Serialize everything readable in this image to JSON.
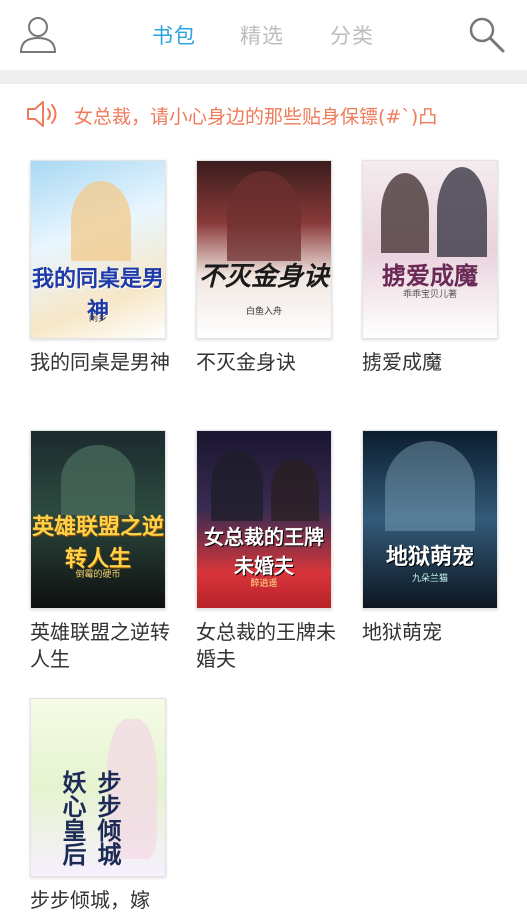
{
  "header": {
    "tabs": [
      {
        "label": "书包",
        "active": true
      },
      {
        "label": "精选",
        "active": false
      },
      {
        "label": "分类",
        "active": false
      }
    ],
    "user_icon": "user-icon",
    "search_icon": "search-icon"
  },
  "notice": {
    "icon": "speaker-icon",
    "text": "女总裁，请小心身边的那些贴身保镖(#`)凸"
  },
  "colors": {
    "accent": "#2aa3e0",
    "inactive_tab": "#bdbdbd",
    "notice_text": "#f07b5b"
  },
  "books": [
    {
      "title": "我的同桌是男神",
      "cover_title": "我的同桌是男神",
      "cover_author": "闲乡"
    },
    {
      "title": "不灭金身诀",
      "cover_title": "不灭金身诀",
      "cover_author": "白鱼入舟"
    },
    {
      "title": "掳爱成魔",
      "cover_title": "掳爱成魔",
      "cover_author": "乖乖宝贝儿著"
    },
    {
      "title": "英雄联盟之逆转人生",
      "cover_title": "英雄联盟之逆转人生",
      "cover_author": "倒霉的硬币"
    },
    {
      "title": "女总裁的王牌未婚夫",
      "cover_title": "女总裁的王牌未婚夫",
      "cover_author": "醉逍遥"
    },
    {
      "title": "地狱萌宠",
      "cover_title": "地狱萌宠",
      "cover_author": "九朵兰猫"
    },
    {
      "title": "步步倾城，嫁",
      "cover_title": "步步倾城 妖心皇后",
      "cover_author": ""
    }
  ]
}
